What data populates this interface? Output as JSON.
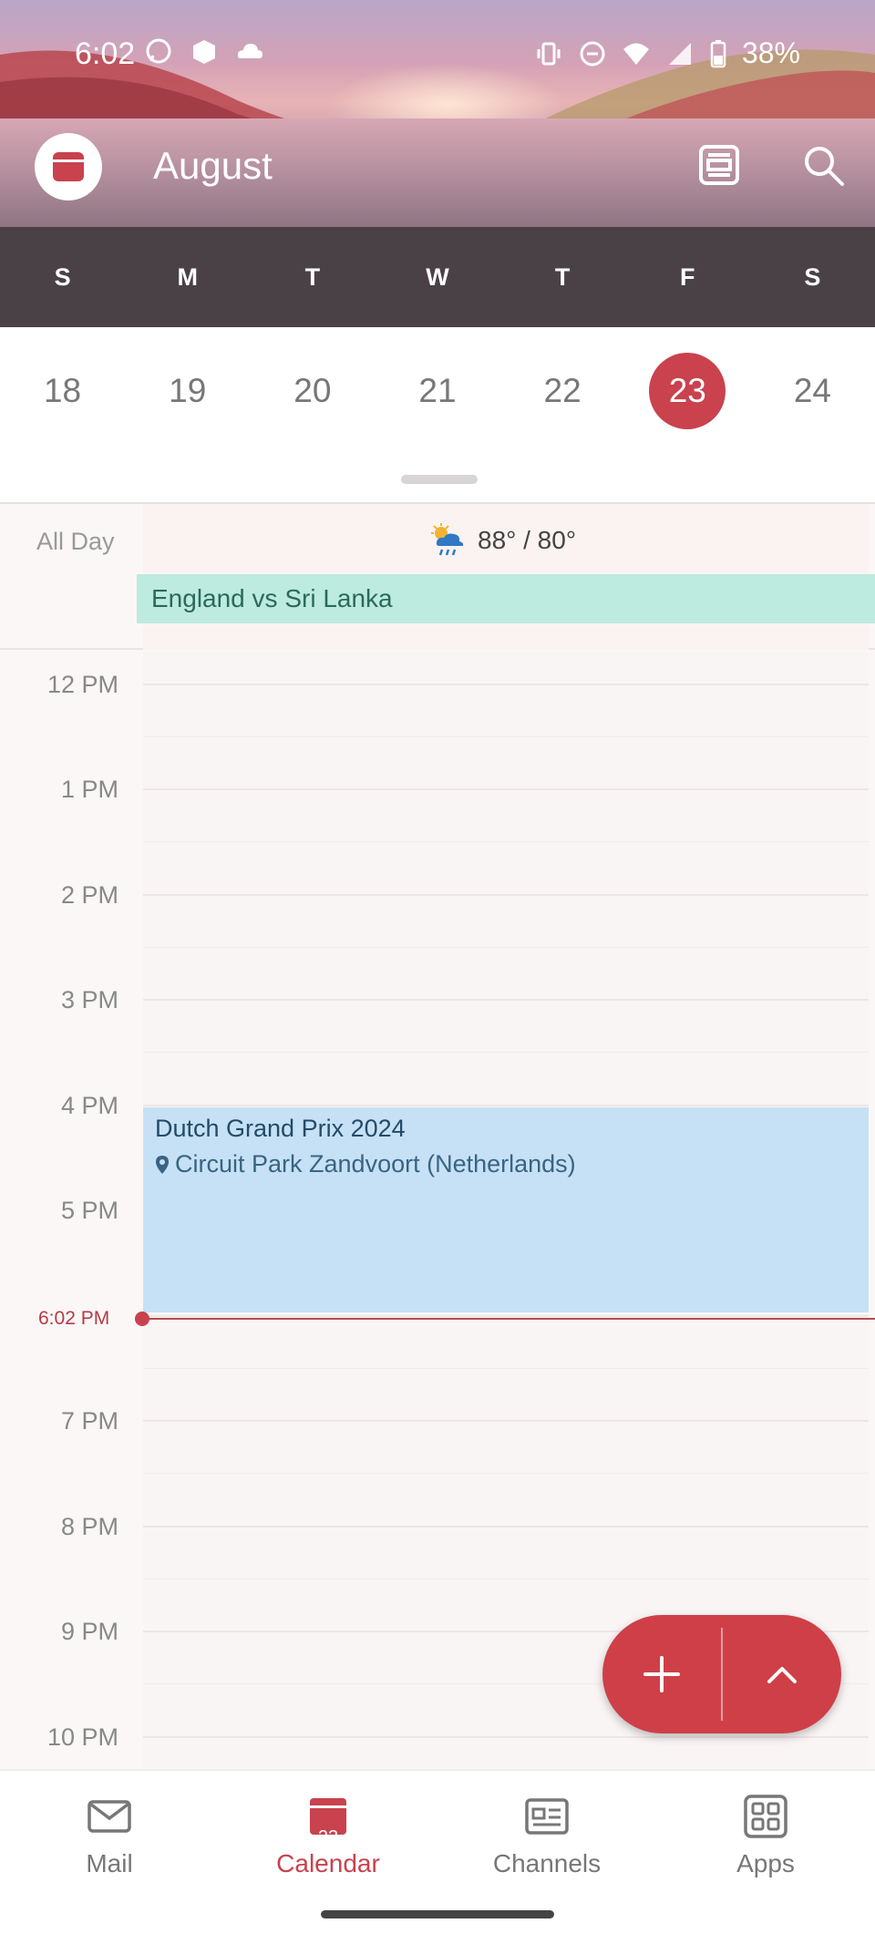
{
  "status_bar": {
    "time": "6:02",
    "battery": "38%",
    "left_icons": [
      "whatsapp-icon",
      "package-icon",
      "cloud-icon"
    ],
    "right_icons": [
      "vibrate-icon",
      "do-not-disturb-icon",
      "wifi-icon",
      "signal-icon",
      "battery-icon"
    ]
  },
  "header": {
    "month": "August",
    "agenda_icon": "agenda-view-icon",
    "search_icon": "search-icon"
  },
  "weekdays": [
    "S",
    "M",
    "T",
    "W",
    "T",
    "F",
    "S"
  ],
  "dates": [
    "18",
    "19",
    "20",
    "21",
    "22",
    "23",
    "24"
  ],
  "selected_date": "23",
  "all_day": {
    "label": "All Day",
    "weather": "88° / 80°",
    "weather_icon": "rain-sun-icon",
    "event": "England vs Sri Lanka"
  },
  "hours": [
    "12 PM",
    "1 PM",
    "2 PM",
    "3 PM",
    "4 PM",
    "5 PM",
    "7 PM",
    "8 PM",
    "9 PM",
    "10 PM"
  ],
  "event": {
    "title": "Dutch Grand Prix 2024",
    "location": "Circuit Park Zandvoort (Netherlands)"
  },
  "now": "6:02 PM",
  "nav": [
    {
      "label": "Mail",
      "icon": "mail-icon"
    },
    {
      "label": "Calendar",
      "icon": "calendar-icon",
      "badge": "23",
      "active": true
    },
    {
      "label": "Channels",
      "icon": "channels-icon"
    },
    {
      "label": "Apps",
      "icon": "apps-icon"
    }
  ],
  "colors": {
    "accent": "#c9424d",
    "event_blue": "#c6e1f6",
    "event_green": "#bdebdf"
  }
}
